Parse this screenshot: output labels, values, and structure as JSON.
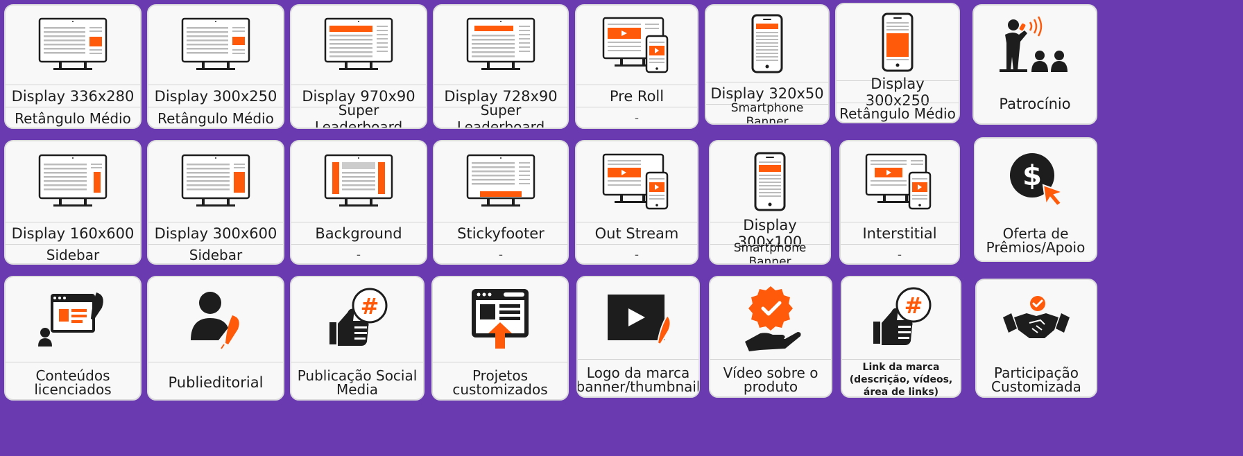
{
  "row1": [
    {
      "title": "Display 336x280",
      "subtitle": "Retângulo Médio",
      "icon": "desktop-monitor-icon"
    },
    {
      "title": "Display 300x250",
      "subtitle": "Retângulo Médio",
      "icon": "desktop-monitor-icon"
    },
    {
      "title": "Display 970x90",
      "subtitle": "Super Leaderboard",
      "icon": "desktop-monitor-icon"
    },
    {
      "title": "Display 728x90",
      "subtitle": "Super Leaderboard",
      "icon": "desktop-monitor-icon"
    },
    {
      "title": "Pre Roll",
      "subtitle": "-",
      "icon": "monitor-phone-video-icon"
    },
    {
      "title": "Display 320x50",
      "subtitle": "Smartphone Banner",
      "icon": "smartphone-icon"
    },
    {
      "title": "Display 300x250",
      "subtitle": "Retângulo Médio",
      "icon": "smartphone-icon"
    },
    {
      "title": "Patrocínio",
      "icon": "speaker-audience-icon"
    }
  ],
  "row2": [
    {
      "title": "Display 160x600",
      "subtitle": "Sidebar",
      "icon": "desktop-monitor-icon"
    },
    {
      "title": "Display 300x600",
      "subtitle": "Sidebar",
      "icon": "desktop-monitor-icon"
    },
    {
      "title": "Background",
      "subtitle": "-",
      "icon": "desktop-monitor-icon"
    },
    {
      "title": "Stickyfooter",
      "subtitle": "-",
      "icon": "desktop-monitor-icon"
    },
    {
      "title": "Out Stream",
      "subtitle": "-",
      "icon": "monitor-phone-video-icon"
    },
    {
      "title": "Display 300x100",
      "subtitle": "Smartphone Banner",
      "icon": "smartphone-icon"
    },
    {
      "title": "Interstitial",
      "subtitle": "-",
      "icon": "monitor-phone-video-icon"
    },
    {
      "title": "Oferta de Prêmios/Apoio",
      "icon": "dollar-cursor-icon"
    }
  ],
  "row3": [
    {
      "title": "Conteúdos licenciados",
      "icon": "licensed-content-icon"
    },
    {
      "title": "Publieditorial",
      "icon": "person-quill-icon"
    },
    {
      "title": "Publicação Social Media",
      "icon": "thumbs-up-hashtag-icon"
    },
    {
      "title": "Projetos customizados",
      "icon": "browser-upload-icon"
    },
    {
      "title": "Logo da marca (banner/thumbnail)",
      "icon": "video-quill-icon"
    },
    {
      "title": "Vídeo sobre o produto",
      "icon": "hand-badge-icon"
    },
    {
      "title": "Link da marca (descrição, vídeos, área de links)",
      "icon": "thumbs-up-hashtag-icon"
    },
    {
      "title": "Participação Customizada",
      "icon": "handshake-check-icon"
    }
  ],
  "colors": {
    "background": "#6a3bb0",
    "card": "#f8f8f8",
    "accent": "#ff5a0a",
    "dark": "#1d1d1d"
  }
}
